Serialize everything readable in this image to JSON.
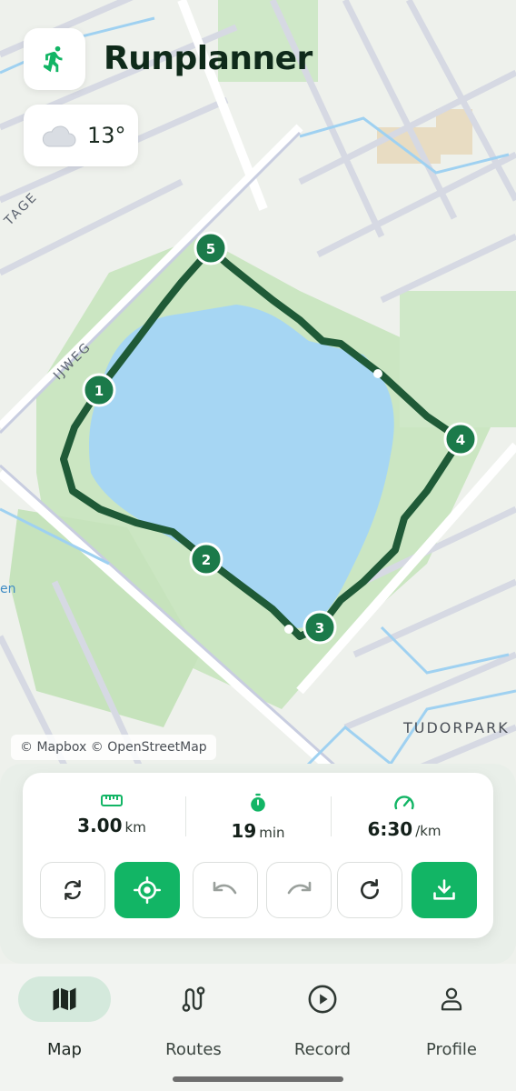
{
  "app": {
    "title": "Runplanner",
    "logo_icon": "running-person-icon",
    "accent_color": "#12b565",
    "route_color": "#1f5a37"
  },
  "weather": {
    "icon": "cloud-icon",
    "temperature": "13°"
  },
  "map": {
    "street_labels": [
      "TAGE",
      "IJWEG",
      "en",
      "TUDORPARK"
    ],
    "attribution": "© Mapbox © OpenStreetMap",
    "waypoints": [
      "1",
      "2",
      "3",
      "4",
      "5"
    ]
  },
  "stats": [
    {
      "icon": "ruler-icon",
      "value": "3.00",
      "unit": "km"
    },
    {
      "icon": "stopwatch-icon",
      "value": "19",
      "unit": "min"
    },
    {
      "icon": "speedometer-icon",
      "value": "6:30",
      "unit": "/km"
    }
  ],
  "actions": [
    {
      "icon": "reverse-route-icon"
    },
    {
      "icon": "locate-icon"
    },
    {
      "icon": "undo-icon"
    },
    {
      "icon": "redo-icon"
    },
    {
      "icon": "reset-icon"
    },
    {
      "icon": "download-icon"
    }
  ],
  "tabs": [
    {
      "label": "Map",
      "icon": "map-icon",
      "active": true
    },
    {
      "label": "Routes",
      "icon": "routes-icon",
      "active": false
    },
    {
      "label": "Record",
      "icon": "play-icon",
      "active": false
    },
    {
      "label": "Profile",
      "icon": "person-icon",
      "active": false
    }
  ]
}
